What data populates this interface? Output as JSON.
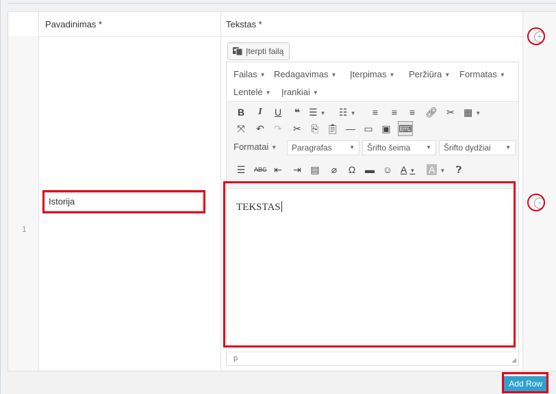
{
  "table": {
    "col_title_header": "Pavadinimas *",
    "col_text_header": "Tekstas *",
    "row_number": "1",
    "title_value": "Istorija"
  },
  "editor": {
    "insert_file_label": "Įterpti failą",
    "menus": [
      "Failas",
      "Redagavimas",
      "Įterpimas",
      "Peržiūra",
      "Formatas",
      "Lentelė",
      "Įrankiai"
    ],
    "format_select": "Formatai",
    "paragraph_select": "Paragrafas",
    "font_family_select": "Šrifto šeima",
    "font_size_select": "Šrifto dydžiai",
    "content": "TEKSTAS",
    "status_path": "p"
  },
  "actions": {
    "add_row": "Add Row",
    "add_symbol": "+",
    "remove_symbol": "−"
  },
  "colors": {
    "highlight": "#e0001a",
    "add_row_bg": "#2ea2cc"
  }
}
